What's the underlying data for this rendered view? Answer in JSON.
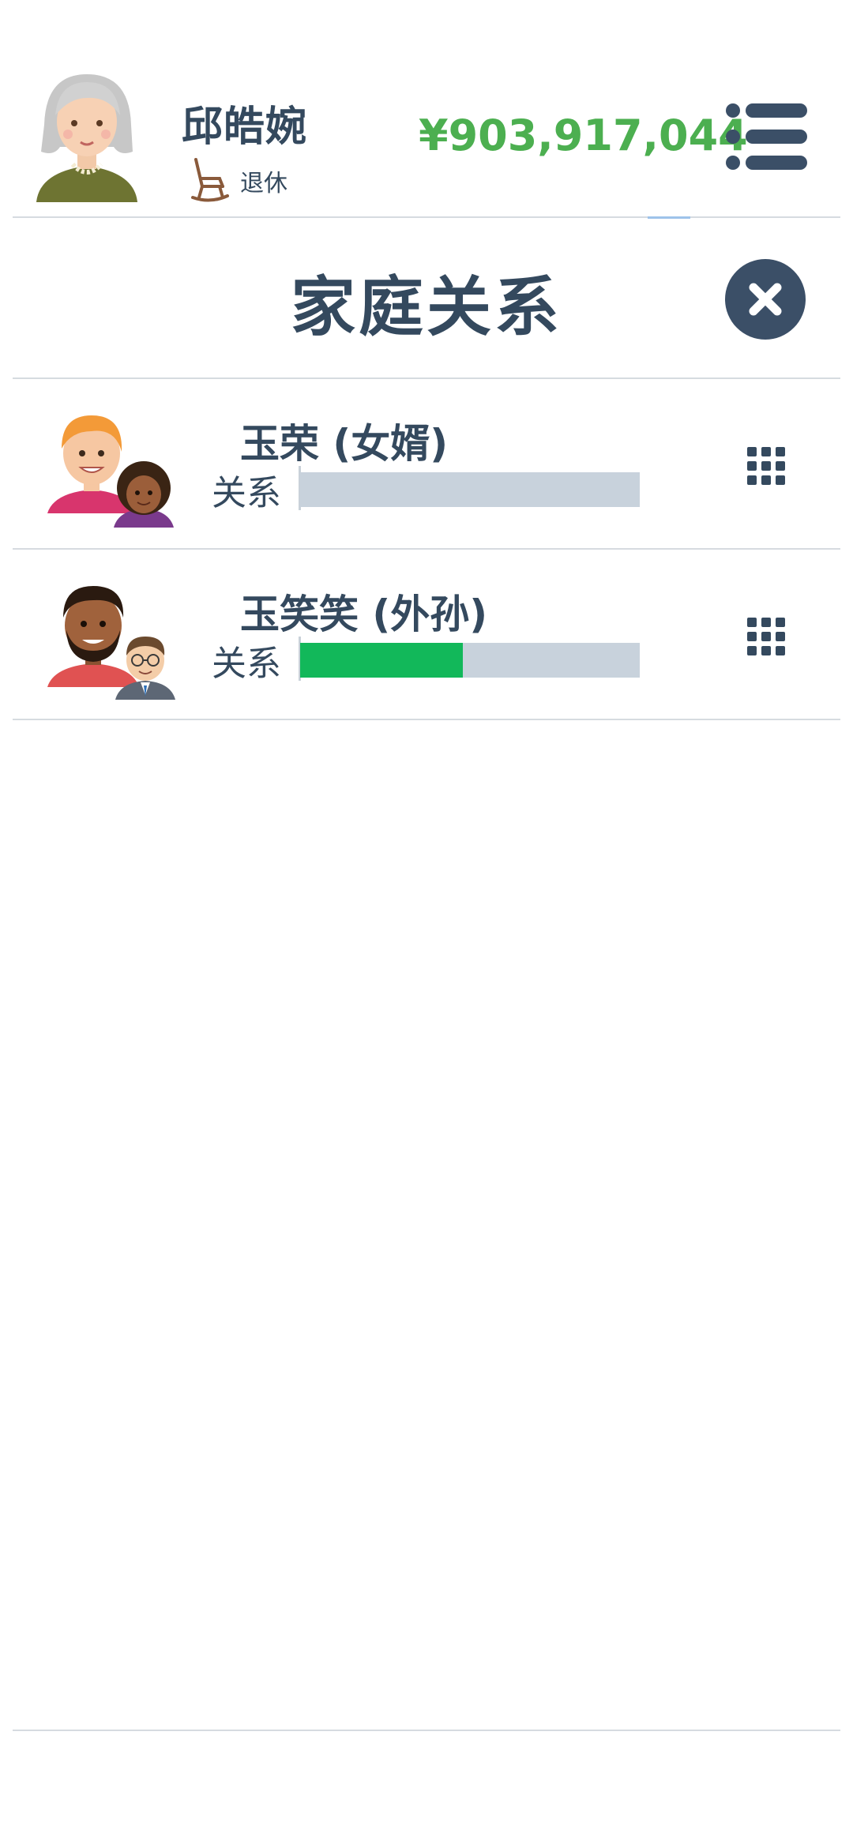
{
  "player": {
    "name": "邱皓婉",
    "status": "退休",
    "money": "¥903,917,044"
  },
  "header": {
    "menu_icon": "list-menu-icon"
  },
  "panel": {
    "title": "家庭关系",
    "close_icon": "close-icon"
  },
  "relations": [
    {
      "name": "玉荣 (女婿)",
      "relation_label": "关系",
      "relation_level": 0.0,
      "avatar_icon": "family-avatar-icon",
      "action_icon": "grid-icon"
    },
    {
      "name": "玉笑笑 (外孙)",
      "relation_label": "关系",
      "relation_level": 0.48,
      "avatar_icon": "family-avatar-icon",
      "action_icon": "grid-icon"
    }
  ],
  "colors": {
    "money": "#4caf50",
    "relation_fill": "#12b85a",
    "relation_track": "#c8d2dc",
    "text": "#34495e",
    "close_bg": "#3b4f67"
  }
}
